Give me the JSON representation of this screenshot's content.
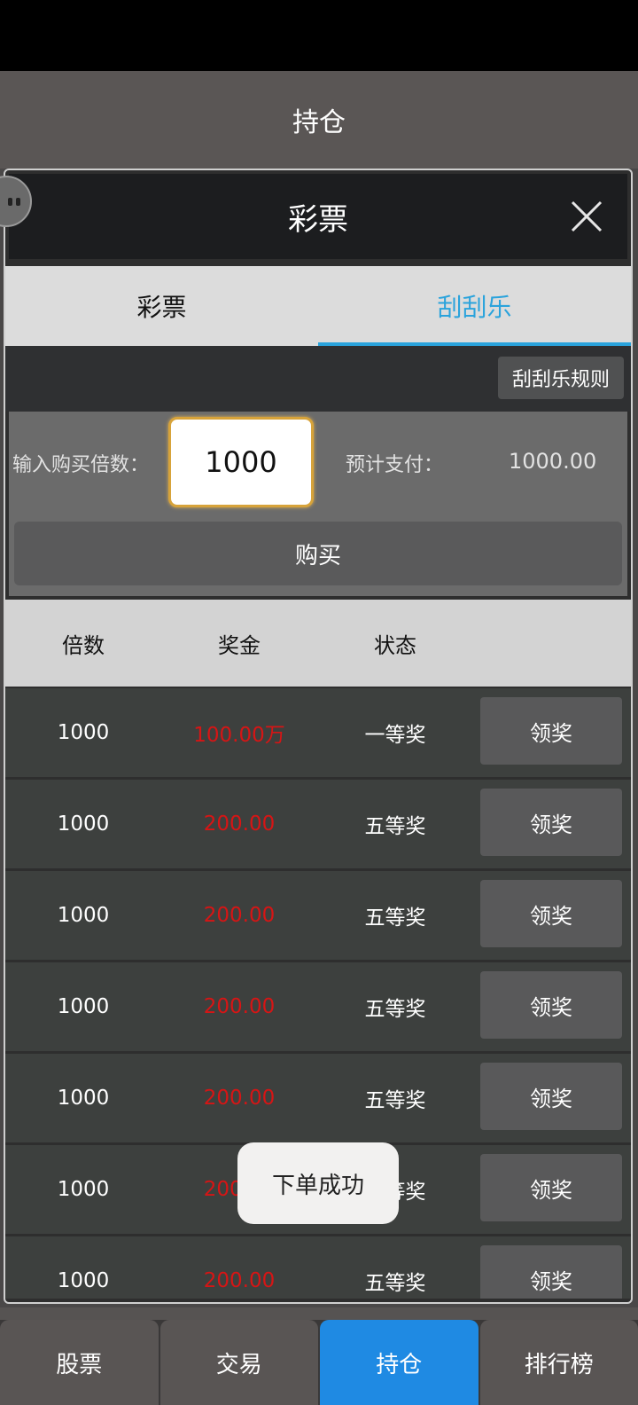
{
  "header": {
    "title": "持仓"
  },
  "dialog": {
    "title": "彩票",
    "tabs": [
      {
        "label": "彩票",
        "active": false
      },
      {
        "label": "刮刮乐",
        "active": true
      }
    ],
    "rules_label": "刮刮乐规则",
    "purchase": {
      "multiplier_label": "输入购买倍数：",
      "multiplier_value": "1000",
      "estimate_label": "预计支付：",
      "estimate_value": "1000.00",
      "buy_label": "购买"
    },
    "table": {
      "columns": [
        "倍数",
        "奖金",
        "状态"
      ],
      "rows": [
        {
          "multiplier": "1000",
          "prize": "100.00万",
          "status": "一等奖",
          "action": "领奖"
        },
        {
          "multiplier": "1000",
          "prize": "200.00",
          "status": "五等奖",
          "action": "领奖"
        },
        {
          "multiplier": "1000",
          "prize": "200.00",
          "status": "五等奖",
          "action": "领奖"
        },
        {
          "multiplier": "1000",
          "prize": "200.00",
          "status": "五等奖",
          "action": "领奖"
        },
        {
          "multiplier": "1000",
          "prize": "200.00",
          "status": "五等奖",
          "action": "领奖"
        },
        {
          "multiplier": "1000",
          "prize": "200.00",
          "status": "五等奖",
          "action": "领奖"
        },
        {
          "multiplier": "1000",
          "prize": "200.00",
          "status": "五等奖",
          "action": "领奖"
        }
      ]
    }
  },
  "toast": {
    "message": "下单成功"
  },
  "bottom_nav": [
    {
      "label": "股票",
      "active": false
    },
    {
      "label": "交易",
      "active": false
    },
    {
      "label": "持仓",
      "active": true
    },
    {
      "label": "排行榜",
      "active": false
    }
  ],
  "colors": {
    "accent": "#2aa3dc",
    "nav_active": "#1f8ae3",
    "prize_red": "#d61515"
  }
}
